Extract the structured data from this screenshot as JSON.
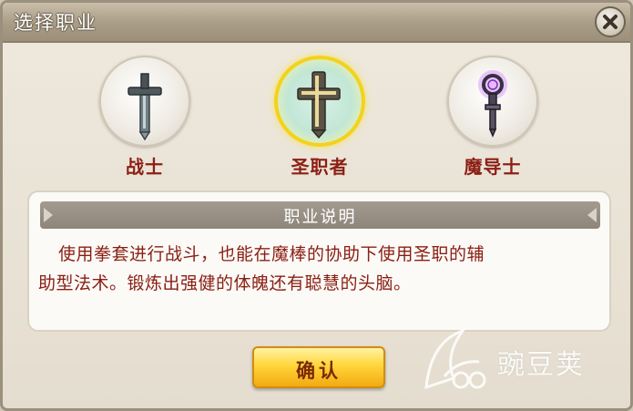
{
  "dialog": {
    "title": "选择职业"
  },
  "classes": [
    {
      "name": "战士",
      "icon": "sword-icon",
      "selected": false
    },
    {
      "name": "圣职者",
      "icon": "cross-icon",
      "selected": true
    },
    {
      "name": "魔导士",
      "icon": "staff-icon",
      "selected": false
    }
  ],
  "description": {
    "header": "职业说明",
    "line1": "使用拳套进行战斗，也能在魔棒的协助下使用圣职的辅",
    "line2": "助型法术。锻炼出强健的体魄还有聪慧的头脑。"
  },
  "confirm_label": "确认",
  "watermark": {
    "text": "豌豆荚"
  },
  "colors": {
    "class_name": "#8c1f14",
    "selected_ring": "#f3d21b",
    "button": "#ffd63a"
  }
}
